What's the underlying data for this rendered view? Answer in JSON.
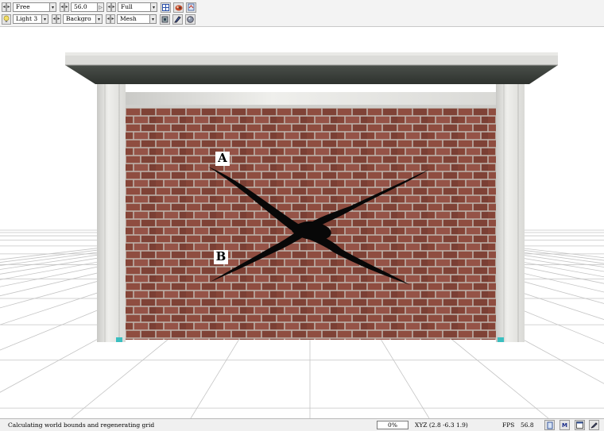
{
  "toolbar": {
    "row1": {
      "camera_mode": "Free",
      "fov": "56.0",
      "view_mode": "Full"
    },
    "row2": {
      "light": "Light 3",
      "background": "Backgro",
      "render_mode": "Mesh"
    }
  },
  "scene": {
    "label_a": "A",
    "label_b": "B",
    "colors": {
      "ground": "#ffffff",
      "grid": "#c4c4c4",
      "brick": "#8b4a3e",
      "mortar": "#bdb1a9",
      "column": "#e4e4e2",
      "roof_dark": "#3d413d",
      "crack": "#080808"
    }
  },
  "status": {
    "message": "Calculating world bounds and regenerating grid",
    "progress": "0%",
    "coords": "XYZ (2.8 -6.3 1.9)",
    "fps_label": "FPS",
    "fps_value": "56.8",
    "m_icon_label": "M"
  }
}
